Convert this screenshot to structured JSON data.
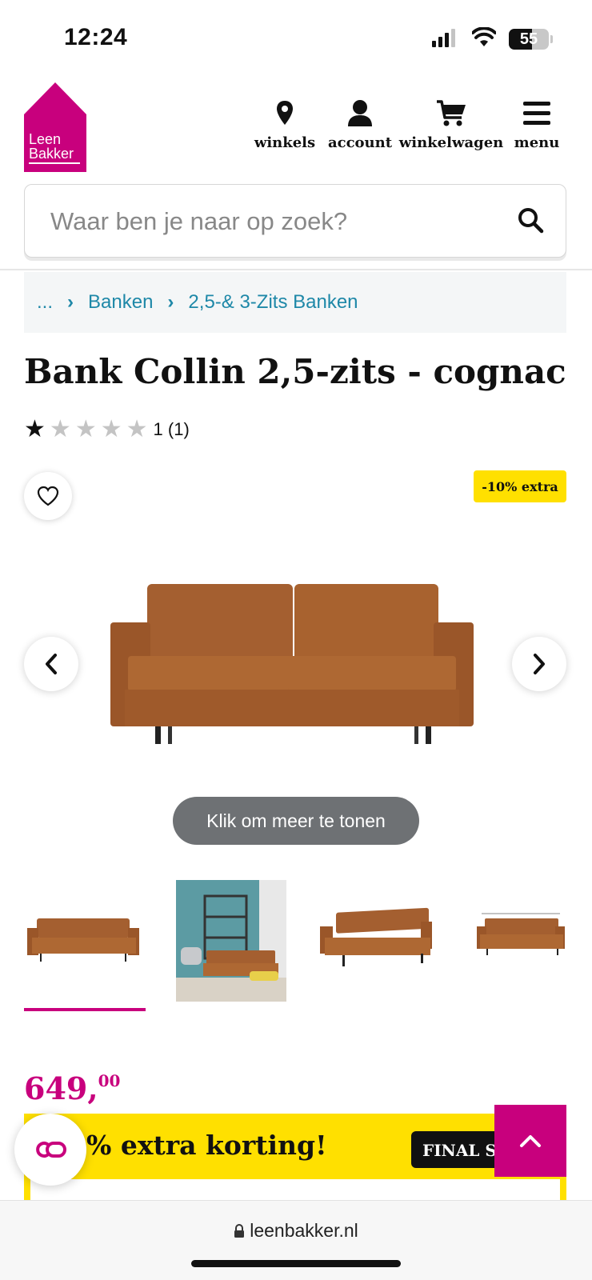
{
  "status": {
    "time": "12:24",
    "battery": "55"
  },
  "header": {
    "logo": {
      "line1": "Leen",
      "line2": "Bakker"
    },
    "nav": [
      {
        "label": "winkels",
        "icon": "location-pin-icon"
      },
      {
        "label": "account",
        "icon": "user-icon"
      },
      {
        "label": "winkelwagen",
        "icon": "cart-icon"
      },
      {
        "label": "menu",
        "icon": "hamburger-icon"
      }
    ]
  },
  "search": {
    "placeholder": "Waar ben je naar op zoek?"
  },
  "breadcrumb": {
    "items": [
      "...",
      "Banken",
      "2,5-& 3-Zits Banken"
    ]
  },
  "product": {
    "title": "Bank Collin 2,5-zits - cognac",
    "rating_value": 1,
    "rating_text": "1 (1)",
    "badge": "-10% extra",
    "gallery_hint": "Klik om meer te tonen",
    "price_main": "649,",
    "price_cents": "00"
  },
  "promo": {
    "text": "% extra korting!",
    "tag": "FINAL S"
  },
  "browser": {
    "url": "leenbakker.nl"
  },
  "colors": {
    "brand": "#c8007d",
    "accent": "#ffe000",
    "link": "#1e88a8"
  }
}
